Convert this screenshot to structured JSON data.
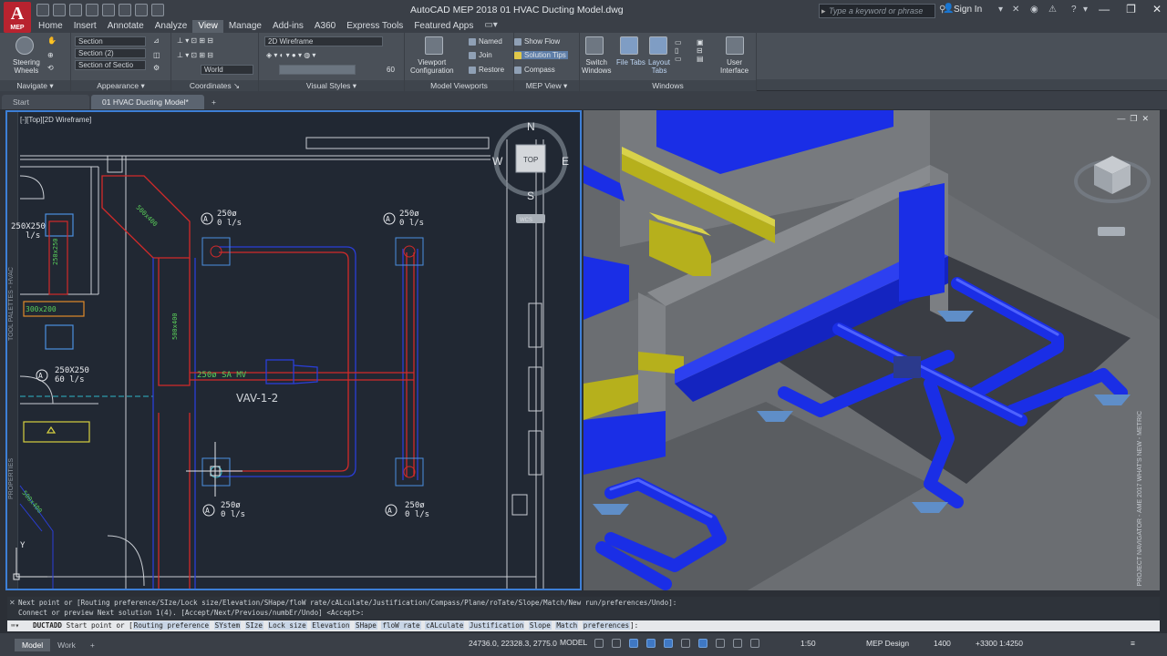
{
  "colors": {
    "accent": "#3d7fd6",
    "logo": "#b8232f",
    "duct_blue": "#1a2ee6",
    "duct_yellow": "#b6b01c",
    "drawing_bg": "#212833"
  },
  "app": {
    "logo_letter": "A",
    "logo_sub": "MEP",
    "title": "AutoCAD MEP 2018    01 HVAC Ducting Model.dwg",
    "search_placeholder": "Type a keyword or phrase",
    "signin": "Sign In",
    "window_buttons": [
      "—",
      "❐",
      "✕"
    ]
  },
  "ribbon_tabs": [
    "Home",
    "Insert",
    "Annotate",
    "Analyze",
    "View",
    "Manage",
    "Add-ins",
    "A360",
    "Express Tools",
    "Featured Apps"
  ],
  "active_tab": "View",
  "ribbon": {
    "steering_wheels": "Steering\nWheels",
    "section_items": [
      "Section",
      "Section (2)",
      "Section of Sectio"
    ],
    "visual_style": "2D Wireframe",
    "ucs_world": "World",
    "viewport_configuration": "Viewport\nConfiguration",
    "named": "Named",
    "join": "Join",
    "restore": "Restore",
    "show_flow": "Show Flow",
    "solution_tips": "Solution Tips",
    "compass": "Compass",
    "switch_windows": "Switch\nWindows",
    "file_tabs": "File Tabs",
    "layout_tabs": "Layout\nTabs",
    "user_interface": "User\nInterface",
    "opacity_value": "60",
    "panels": [
      "Navigate",
      "Appearance",
      "Coordinates",
      "Visual Styles",
      "Model Viewports",
      "MEP View",
      "Windows"
    ]
  },
  "file_tabs": {
    "start": "Start",
    "doc": "01 HVAC Ducting Model*",
    "add": "+"
  },
  "viewport_left": {
    "label": "[-][Top][2D Wireframe]",
    "compass": {
      "n": "N",
      "s": "S",
      "e": "E",
      "w": "W",
      "top": "TOP",
      "wcs": "WCS"
    },
    "palette_labels": [
      "TOOL PALETTES - HVAC",
      "PROPERTIES"
    ],
    "drawing_labels": {
      "diffuser_size_1": "250ø",
      "diffuser_flow_1": "0 l/s",
      "diffuser_size_2": "250ø",
      "diffuser_flow_2": "0 l/s",
      "diffuser_size_3": "250ø",
      "diffuser_flow_3": "0 l/s",
      "diffuser_size_4": "250ø",
      "diffuser_flow_4": "0 l/s",
      "grille_size": "250X250",
      "grille_flow": "60 l/s",
      "grille_size_top": "250X250",
      "grille_flow_top": "l/s",
      "duct_300x200": "300x200",
      "duct_250x250": "250x250",
      "duct_500x400_a": "500x400",
      "duct_500x400_b": "500x400",
      "duct_500x400_c": "500x400",
      "vav_name": "VAV-1-2",
      "vav_inlet": "250ø SA MV",
      "tag_a": "A",
      "axis_y": "Y"
    }
  },
  "viewport_right": {
    "controls": [
      "—",
      "❐",
      "✕"
    ],
    "palette_label": "PROJECT NAVIGATOR - AME 2017 WHAT'S NEW - METRIC"
  },
  "command": {
    "history_1": "Next point or [Routing preference/SIze/Lock size/Elevation/SHape/floW rate/cALculate/Justification/Compass/Plane/roTate/Slope/Match/New run/preferences/Undo]:",
    "history_2": "Connect or preview Next solution 1(4). [Accept/Next/Previous/numbEr/Undo] <Accept>:",
    "prompt": "DUCTADD",
    "prompt_text": "Start point or",
    "options": [
      "Routing preference",
      "SYstem",
      "SIze",
      "Lock size",
      "Elevation",
      "SHape",
      "floW rate",
      "cALculate",
      "Justification",
      "Slope",
      "Match",
      "preferences"
    ],
    "close": "✕"
  },
  "status": {
    "tabs": [
      "Model",
      "Work"
    ],
    "add": "+",
    "coordinates": "24736.0, 22328.3, 2775.0",
    "model": "MODEL",
    "scale": "1:50",
    "workspace": "MEP Design",
    "elevation": "1400",
    "offset": "+3300",
    "scale2": "1:4250"
  }
}
